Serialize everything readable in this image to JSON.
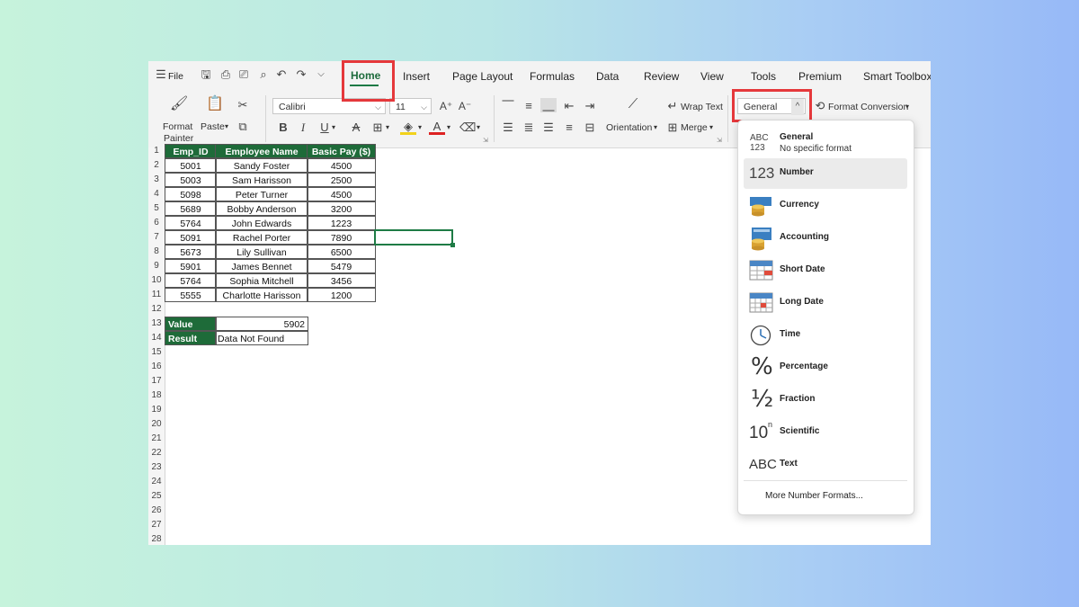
{
  "menu": {
    "file": "File",
    "tabs": [
      "Home",
      "Insert",
      "Page Layout",
      "Formulas",
      "Data",
      "Review",
      "View",
      "Tools",
      "Premium",
      "Smart Toolbox"
    ]
  },
  "ribbon": {
    "format_painter_line1": "Format",
    "format_painter_line2": "Painter",
    "paste": "Paste",
    "font_name": "Calibri",
    "font_size": "11",
    "wrap_text": "Wrap Text",
    "orientation": "Orientation",
    "merge": "Merge",
    "number_format": "General",
    "format_conversion": "Format Conversion",
    "bold": "B",
    "italic": "I",
    "underline": "U",
    "strike": "A"
  },
  "rows": [
    "1",
    "2",
    "3",
    "4",
    "5",
    "6",
    "7",
    "8",
    "9",
    "10",
    "11",
    "12",
    "13",
    "14",
    "15",
    "16",
    "17",
    "18",
    "19",
    "20",
    "21",
    "22",
    "23",
    "24",
    "25",
    "26",
    "27",
    "28"
  ],
  "table": {
    "headers": [
      "Emp_ID",
      "Employee Name",
      "Basic Pay ($)"
    ],
    "rows": [
      [
        "5001",
        "Sandy Foster",
        "4500"
      ],
      [
        "5003",
        "Sam Harisson",
        "2500"
      ],
      [
        "5098",
        "Peter Turner",
        "4500"
      ],
      [
        "5689",
        "Bobby Anderson",
        "3200"
      ],
      [
        "5764",
        "John Edwards",
        "1223"
      ],
      [
        "5091",
        "Rachel Porter",
        "7890"
      ],
      [
        "5673",
        "Lily Sullivan",
        "6500"
      ],
      [
        "5901",
        "James Bennet",
        "5479"
      ],
      [
        "5764",
        "Sophia Mitchell",
        "3456"
      ],
      [
        "5555",
        "Charlotte Harisson",
        "1200"
      ]
    ]
  },
  "lookup": {
    "value_label": "Value",
    "value": "5902",
    "result_label": "Result",
    "result": "Data Not Found"
  },
  "dropdown": {
    "options": [
      {
        "label": "General",
        "sub": "No specific format",
        "icon": "general-icon"
      },
      {
        "label": "Number",
        "icon": "number-icon"
      },
      {
        "label": "Currency",
        "icon": "currency-icon"
      },
      {
        "label": "Accounting",
        "icon": "accounting-icon"
      },
      {
        "label": "Short Date",
        "icon": "short-date-icon"
      },
      {
        "label": "Long Date",
        "icon": "long-date-icon"
      },
      {
        "label": "Time",
        "icon": "clock-icon"
      },
      {
        "label": "Percentage",
        "icon": "percent-icon"
      },
      {
        "label": "Fraction",
        "icon": "fraction-icon"
      },
      {
        "label": "Scientific",
        "icon": "scientific-icon"
      },
      {
        "label": "Text",
        "icon": "text-icon"
      }
    ],
    "more": "More Number Formats...",
    "icon_text": {
      "general_top": "ABC",
      "general_bottom": "123",
      "number": "123",
      "percent": "%",
      "fraction": "½",
      "scientific": "10",
      "scientific_exp": "n",
      "text": "ABC"
    }
  },
  "colors": {
    "accent": "#1e6b39",
    "highlight": "#e5383b"
  }
}
